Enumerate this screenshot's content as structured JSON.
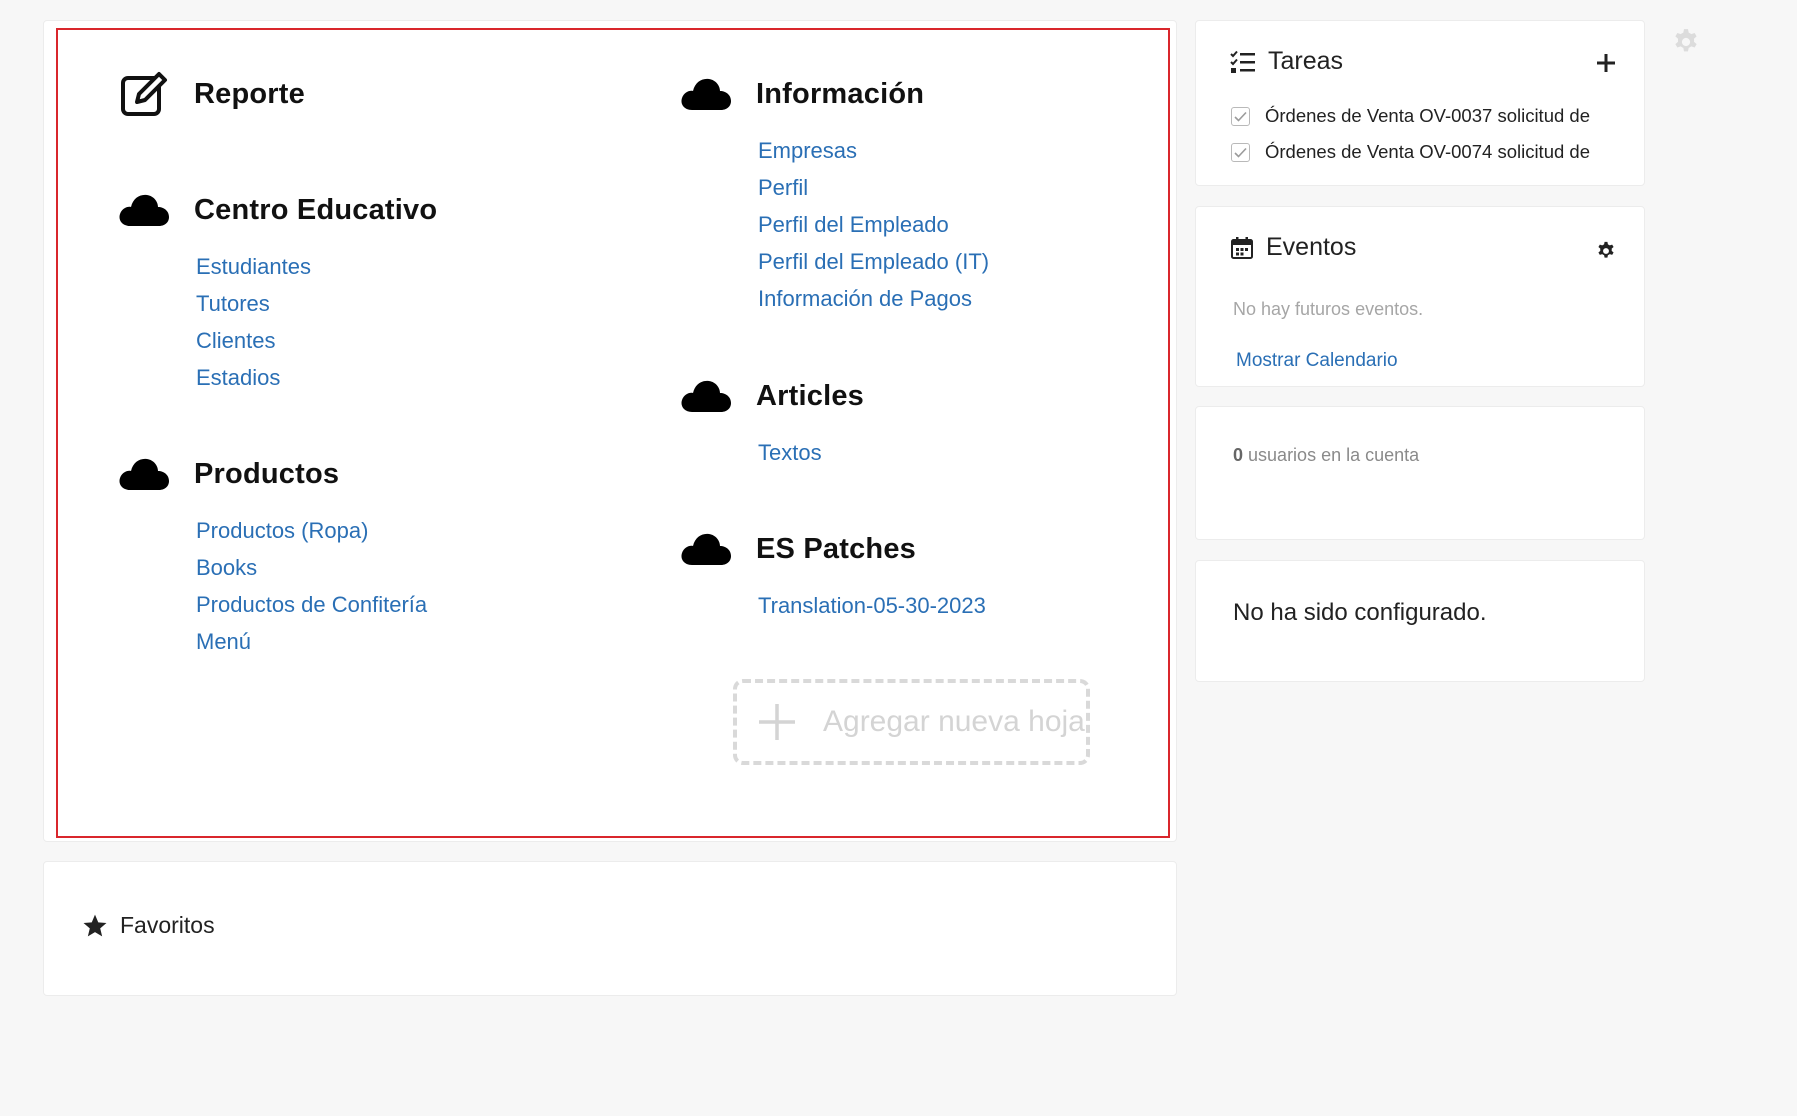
{
  "workspace": {
    "groups": {
      "reporte": {
        "title": "Reporte",
        "icon": "edit-icon",
        "links": []
      },
      "centro": {
        "title": "Centro Educativo",
        "icon": "cloud-icon",
        "links": [
          "Estudiantes",
          "Tutores",
          "Clientes",
          "Estadios"
        ]
      },
      "productos": {
        "title": "Productos",
        "icon": "cloud-icon",
        "links": [
          "Productos (Ropa)",
          "Books",
          "Productos de Confitería",
          "Menú"
        ]
      },
      "informacion": {
        "title": "Información",
        "icon": "cloud-icon",
        "links": [
          "Empresas",
          "Perfil",
          "Perfil del Empleado",
          "Perfil del Empleado (IT)",
          "Información de Pagos"
        ]
      },
      "articles": {
        "title": "Articles",
        "icon": "cloud-icon",
        "links": [
          "Textos"
        ]
      },
      "patches": {
        "title": "ES Patches",
        "icon": "cloud-icon",
        "links": [
          "Translation-05-30-2023"
        ]
      }
    },
    "add_sheet_label": "Agregar nueva hoja"
  },
  "favorites": {
    "label": "Favoritos",
    "icon": "star-icon"
  },
  "tasks": {
    "title": "Tareas",
    "items": [
      "Órdenes de Venta OV-0037 solicitud de",
      "Órdenes de Venta OV-0074 solicitud de"
    ]
  },
  "events": {
    "title": "Eventos",
    "empty_text": "No hay futuros eventos.",
    "calendar_link": "Mostrar Calendario"
  },
  "users": {
    "count": "0",
    "text": "usuarios en la cuenta"
  },
  "config": {
    "text": "No ha sido configurado."
  },
  "colors": {
    "link": "#2a6fb5",
    "highlight": "#d9262c",
    "background": "#f7f7f7"
  }
}
